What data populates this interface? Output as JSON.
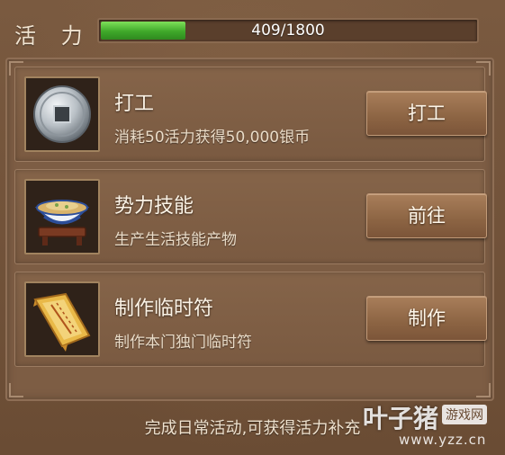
{
  "header": {
    "label": "活 力",
    "energy_text": "409/1800",
    "energy_fraction": 0.227
  },
  "tasks": [
    {
      "title": "打工",
      "desc": "消耗50活力获得50,000银币",
      "button": "打工",
      "icon": "silver-coin-icon"
    },
    {
      "title": "势力技能",
      "desc": "生产生活技能产物",
      "button": "前往",
      "icon": "porcelain-bowl-icon"
    },
    {
      "title": "制作临时符",
      "desc": "制作本门独门临时符",
      "button": "制作",
      "icon": "talisman-scroll-icon"
    }
  ],
  "footer": {
    "hint": "完成日常活动,可获得活力补充"
  },
  "watermark": {
    "brand": "叶子猪",
    "tag": "游戏网",
    "url": "www.yzz.cn"
  },
  "colors": {
    "background": "#6e5038",
    "bar_fill": "#3fa82a",
    "button": "#8c6443"
  }
}
